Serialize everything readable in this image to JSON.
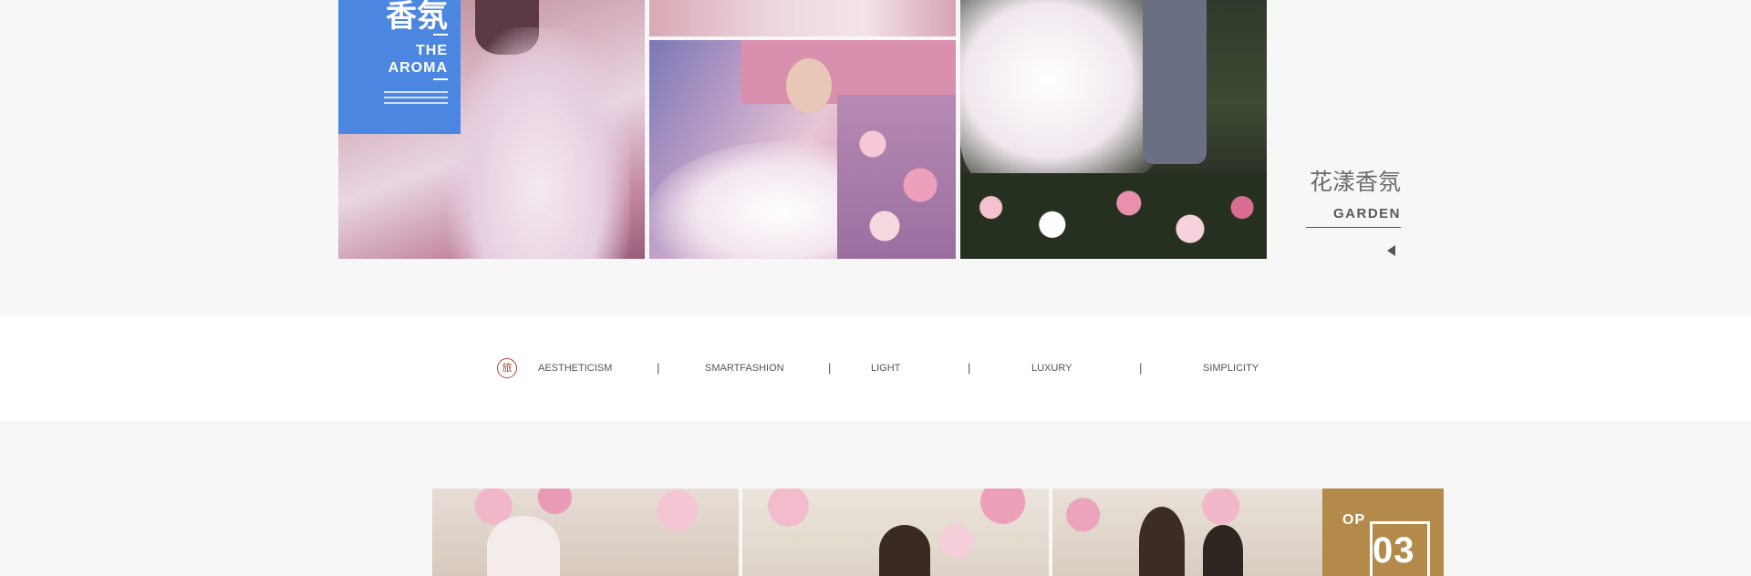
{
  "gallery": {
    "feature_panel": {
      "title_cn": "香氛",
      "title_en_line1": "THE",
      "title_en_line2": "AROMA"
    },
    "caption": {
      "title_cn": "花漾香氛",
      "subtitle_en": "GARDEN"
    }
  },
  "nav": {
    "logo_glyph": "旅",
    "items": [
      {
        "label": "AESTHETICISM"
      },
      {
        "label": "SMARTFASHION"
      },
      {
        "label": "LIGHT"
      },
      {
        "label": "LUXURY"
      },
      {
        "label": "SIMPLICITY"
      }
    ],
    "separator": "|"
  },
  "bottom": {
    "badge": {
      "prefix": "OP",
      "number": "03"
    }
  },
  "colors": {
    "aroma_blue": "#4b87e0",
    "badge_gold": "#b48a4a",
    "logo_red": "#a8432d"
  }
}
